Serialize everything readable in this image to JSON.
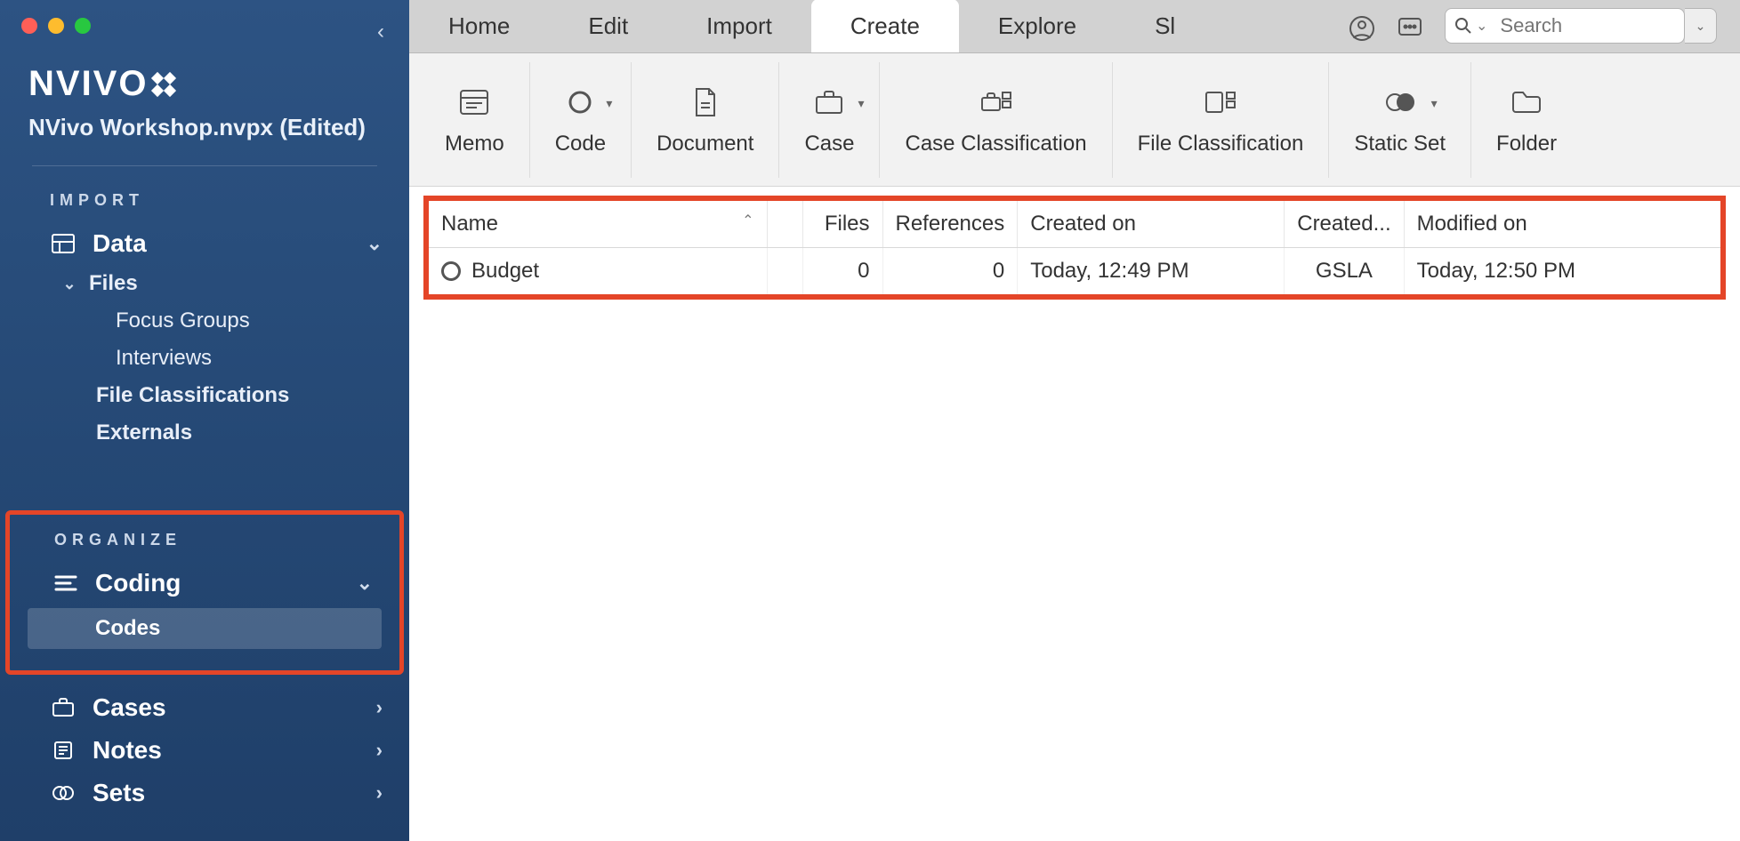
{
  "app": {
    "logo_text": "NVIVO",
    "project_title": "NVivo Workshop.nvpx (Edited)"
  },
  "sidebar": {
    "sections": {
      "import_label": "IMPORT",
      "organize_label": "ORGANIZE"
    },
    "data": {
      "label": "Data",
      "files": "Files",
      "focus_groups": "Focus Groups",
      "interviews": "Interviews",
      "file_classifications": "File Classifications",
      "externals": "Externals"
    },
    "coding": {
      "label": "Coding",
      "codes": "Codes"
    },
    "cases": "Cases",
    "notes": "Notes",
    "sets": "Sets"
  },
  "menu": {
    "tabs": [
      "Home",
      "Edit",
      "Import",
      "Create",
      "Explore",
      "Sl"
    ],
    "active_index": 3,
    "search_placeholder": "Search"
  },
  "ribbon": {
    "memo": "Memo",
    "code": "Code",
    "document": "Document",
    "case": "Case",
    "case_classification": "Case Classification",
    "file_classification": "File Classification",
    "static_set": "Static Set",
    "folder": "Folder"
  },
  "table": {
    "headers": {
      "name": "Name",
      "files": "Files",
      "references": "References",
      "created_on": "Created on",
      "created_by": "Created...",
      "modified_on": "Modified on"
    },
    "rows": [
      {
        "name": "Budget",
        "files": "0",
        "references": "0",
        "created_on": "Today, 12:49 PM",
        "created_by": "GSLA",
        "modified_on": "Today, 12:50 PM"
      }
    ]
  }
}
